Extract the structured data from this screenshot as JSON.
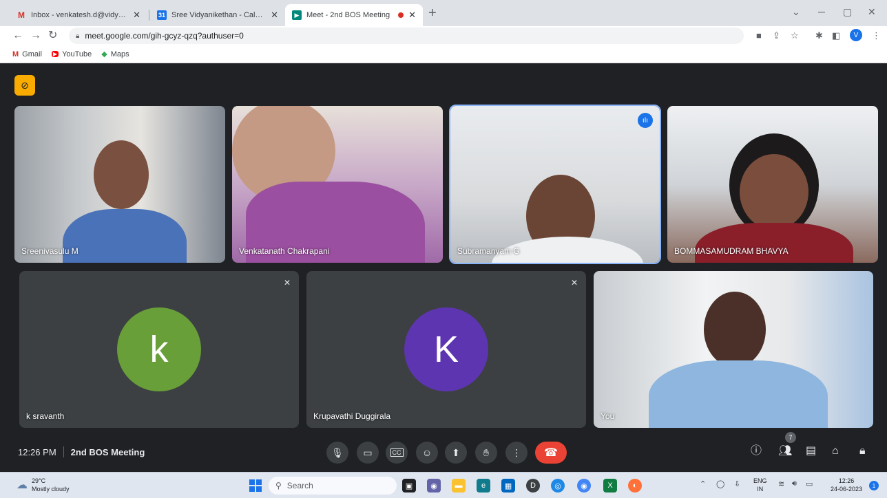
{
  "browser": {
    "tabs": [
      {
        "title": "Inbox - venkatesh.d@vidyaniketh",
        "icon": "gmail-icon",
        "color": "#d93025"
      },
      {
        "title": "Sree Vidyanikethan - Calendar -",
        "icon": "calendar-icon",
        "color": "#1a73e8"
      },
      {
        "title": "Meet - 2nd BOS Meeting",
        "icon": "meet-icon",
        "color": "#00897b"
      }
    ],
    "new_tab": "+",
    "url": "meet.google.com/gih-gcyz-qzq?authuser=0",
    "profile_initial": "V",
    "bookmarks": [
      {
        "label": "Gmail",
        "icon": "gmail-icon"
      },
      {
        "label": "YouTube",
        "icon": "youtube-icon"
      },
      {
        "label": "Maps",
        "icon": "maps-icon"
      }
    ]
  },
  "meet": {
    "participants": [
      {
        "name": "Sreenivasulu M",
        "type": "video"
      },
      {
        "name": "Venkatanath Chakrapani",
        "type": "video"
      },
      {
        "name": "Subramanyam G",
        "type": "video",
        "speaking": true
      },
      {
        "name": "BOMMASAMUDRAM BHAVYA",
        "type": "video"
      },
      {
        "name": "k sravanth",
        "type": "avatar",
        "initial": "k",
        "color": "#689f38",
        "muted": true
      },
      {
        "name": "Krupavathi Duggirala",
        "type": "avatar",
        "initial": "K",
        "color": "#5e35b1",
        "muted": true
      },
      {
        "name": "You",
        "type": "video"
      }
    ],
    "time": "12:26 PM",
    "meeting_title": "2nd BOS Meeting",
    "participant_count": "7"
  },
  "taskbar": {
    "temperature": "29°C",
    "weather": "Mostly cloudy",
    "search_placeholder": "Search",
    "lang_top": "ENG",
    "lang_bottom": "IN",
    "clock_time": "12:26",
    "clock_date": "24-06-2023",
    "notification_count": "1"
  }
}
